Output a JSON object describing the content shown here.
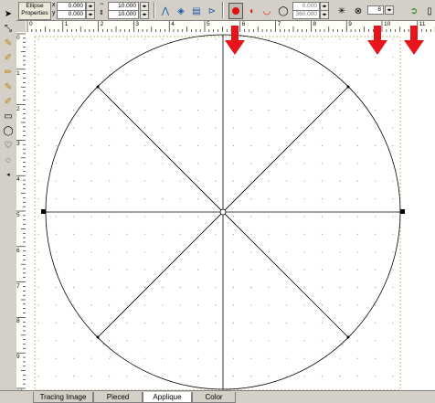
{
  "toolbar": {
    "shape_title_line1": "Ellipse",
    "shape_title_line2": "Properties",
    "x_label": "x",
    "y_label": "y",
    "x_value": "0.000",
    "y_value": "0.000",
    "w_value": "10.000",
    "h_value": "10.000",
    "angle_start": "0.000",
    "angle_end": "360.000",
    "segments_value": "8"
  },
  "ruler": {
    "h_labels": [
      "0",
      "1",
      "2",
      "3",
      "4",
      "5",
      "6",
      "7",
      "8",
      "9",
      "10",
      "11"
    ],
    "v_labels": [
      "0",
      "1",
      "2",
      "3",
      "4",
      "5",
      "6",
      "7",
      "8",
      "9",
      "10"
    ]
  },
  "tabs": [
    {
      "label": "Tracing Image"
    },
    {
      "label": "Pieced"
    },
    {
      "label": "Applique"
    },
    {
      "label": "Color"
    }
  ],
  "colors": {
    "accent_arrow": "#e8141c",
    "selected_tool_fill": "#e01010",
    "canvas": "#ffffff",
    "chrome": "#d4d0c8"
  }
}
